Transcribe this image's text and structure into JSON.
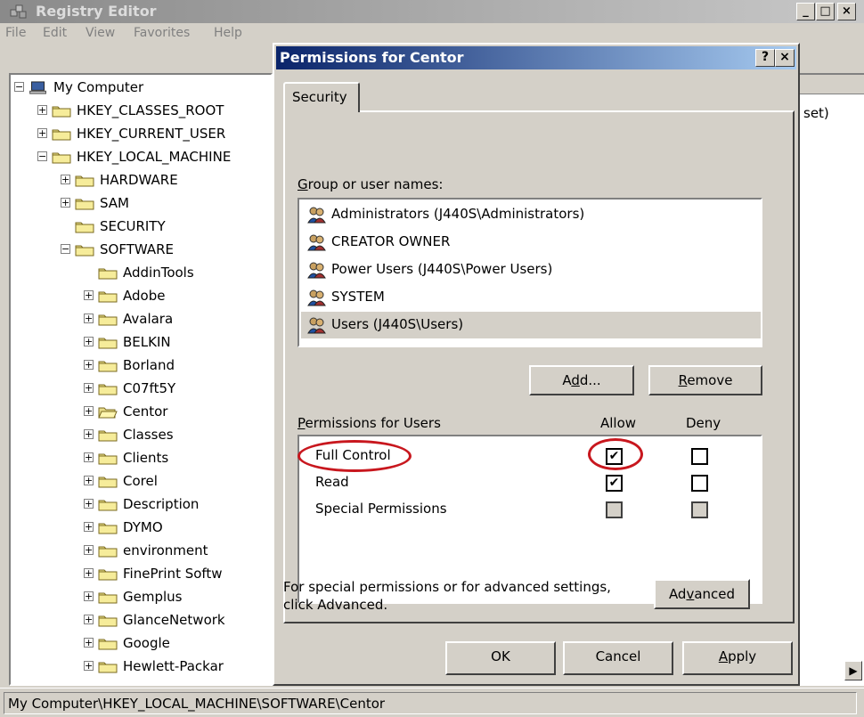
{
  "registry": {
    "title": "Registry Editor",
    "menu": [
      "File",
      "Edit",
      "View",
      "Favorites",
      "Help"
    ],
    "tree": [
      {
        "label": "My Computer",
        "expander": "−",
        "icon": "computer-icon"
      },
      {
        "label": "HKEY_CLASSES_ROOT",
        "expander": "+"
      },
      {
        "label": "HKEY_CURRENT_USER",
        "expander": "+"
      },
      {
        "label": "HKEY_LOCAL_MACHINE",
        "expander": "−"
      },
      {
        "label": "HARDWARE",
        "expander": "+"
      },
      {
        "label": "SAM",
        "expander": "+"
      },
      {
        "label": "SECURITY",
        "expander": ""
      },
      {
        "label": "SOFTWARE",
        "expander": "−"
      },
      {
        "label": "AddinTools",
        "expander": ""
      },
      {
        "label": "Adobe",
        "expander": "+"
      },
      {
        "label": "Avalara",
        "expander": "+"
      },
      {
        "label": "BELKIN",
        "expander": "+"
      },
      {
        "label": "Borland",
        "expander": "+"
      },
      {
        "label": "C07ft5Y",
        "expander": "+"
      },
      {
        "label": "Centor",
        "expander": "+",
        "open": true
      },
      {
        "label": "Classes",
        "expander": "+"
      },
      {
        "label": "Clients",
        "expander": "+"
      },
      {
        "label": "Corel",
        "expander": "+"
      },
      {
        "label": "Description",
        "expander": "+"
      },
      {
        "label": "DYMO",
        "expander": "+"
      },
      {
        "label": "environment",
        "expander": "+"
      },
      {
        "label": "FinePrint Softw",
        "expander": "+"
      },
      {
        "label": "Gemplus",
        "expander": "+"
      },
      {
        "label": "GlanceNetwork",
        "expander": "+"
      },
      {
        "label": "Google",
        "expander": "+"
      },
      {
        "label": "Hewlett-Packar",
        "expander": "+"
      }
    ],
    "values_fragment": "set)",
    "status": "My Computer\\HKEY_LOCAL_MACHINE\\SOFTWARE\\Centor"
  },
  "dialog": {
    "title": "Permissions for Centor",
    "help_btn": "?",
    "close_btn": "×",
    "tab": "Security",
    "group_label": {
      "accel": "G",
      "rest": "roup or user names:"
    },
    "users": [
      "Administrators (J440S\\Administrators)",
      "CREATOR OWNER",
      "Power Users (J440S\\Power Users)",
      "SYSTEM",
      "Users (J440S\\Users)"
    ],
    "selected_user_index": 4,
    "add_btn": {
      "pre": "A",
      "accel": "d",
      "post": "d..."
    },
    "remove_btn": {
      "accel": "R",
      "post": "emove"
    },
    "perm_header": {
      "accel": "P",
      "rest": "ermissions for Users"
    },
    "allow_col": "Allow",
    "deny_col": "Deny",
    "permissions": [
      {
        "name": "Full Control",
        "allow": "checked",
        "deny": "unchecked"
      },
      {
        "name": "Read",
        "allow": "checked",
        "deny": "unchecked"
      },
      {
        "name": "Special Permissions",
        "allow": "disabled",
        "deny": "disabled"
      }
    ],
    "advanced_note": [
      "For special permissions or for advanced settings,",
      "click Advanced."
    ],
    "advanced_btn": {
      "pre": "Ad",
      "accel": "v",
      "post": "anced"
    },
    "ok_btn": "OK",
    "cancel_btn": "Cancel",
    "apply_btn": {
      "accel": "A",
      "post": "pply"
    },
    "highlight_color": "#c8171e"
  },
  "window_controls": [
    "_",
    "□",
    "×"
  ]
}
